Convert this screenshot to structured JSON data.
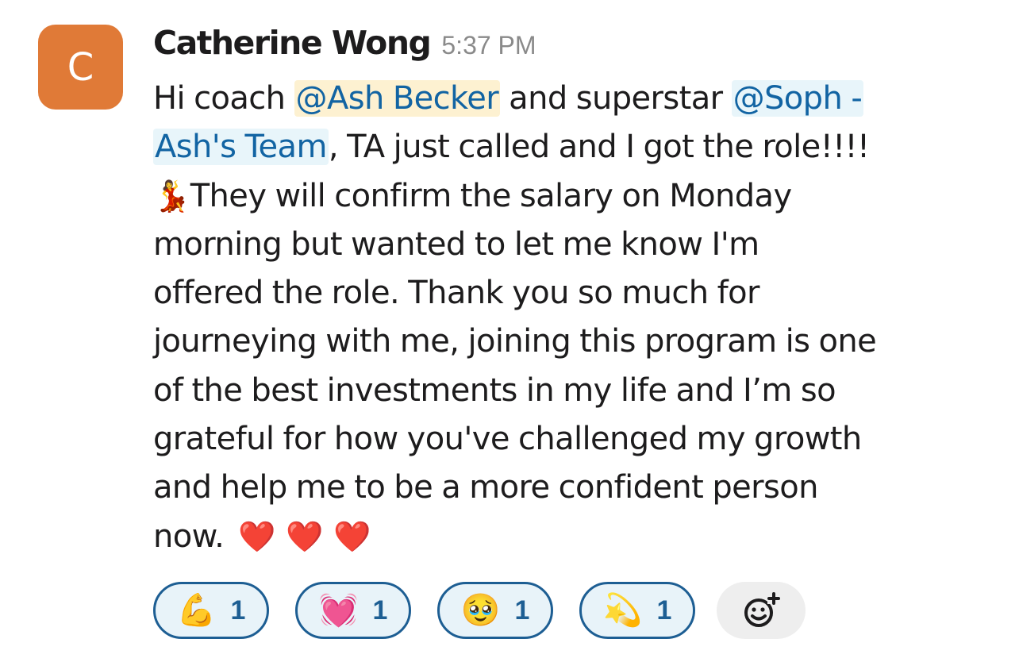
{
  "message": {
    "author": "Catherine Wong",
    "avatar_letter": "C",
    "avatar_color": "#E07A37",
    "timestamp": "5:37 PM",
    "body_lines": [
      {
        "pre": "Hi coach ",
        "mention": "@Ash Becker",
        "post": " and superstar ",
        "mention2": "@Soph -"
      },
      {
        "mention": "Ash's Team",
        "post": ", TA just called and I got the role!!!!"
      },
      {
        "emoji": "💃",
        "text": "They will confirm the salary on Monday"
      },
      {
        "text": "morning but wanted to let me know I'm"
      },
      {
        "text": "offered the role. Thank you so much for"
      },
      {
        "text": "journeying with me, joining this program is one"
      },
      {
        "text": "of the best investments in my life and I’m so"
      },
      {
        "text": "grateful for how you've challenged my growth"
      },
      {
        "text": "and help me to be a more confident person"
      },
      {
        "text": "now.",
        "emoji": "❤️"
      }
    ]
  },
  "reactions": [
    {
      "emoji": "💪",
      "icon": "flexed-biceps-icon",
      "count": "1"
    },
    {
      "emoji": "💓",
      "icon": "beating-heart-icon",
      "count": "1"
    },
    {
      "emoji": "🥹",
      "icon": "holding-back-tears-icon",
      "count": "1"
    },
    {
      "emoji": "💫",
      "icon": "dizzy-star-icon",
      "count": "1"
    }
  ],
  "colors": {
    "mention_text": "#1264A3",
    "reaction_border": "#1D5E93",
    "timestamp": "#8A8A8A"
  }
}
